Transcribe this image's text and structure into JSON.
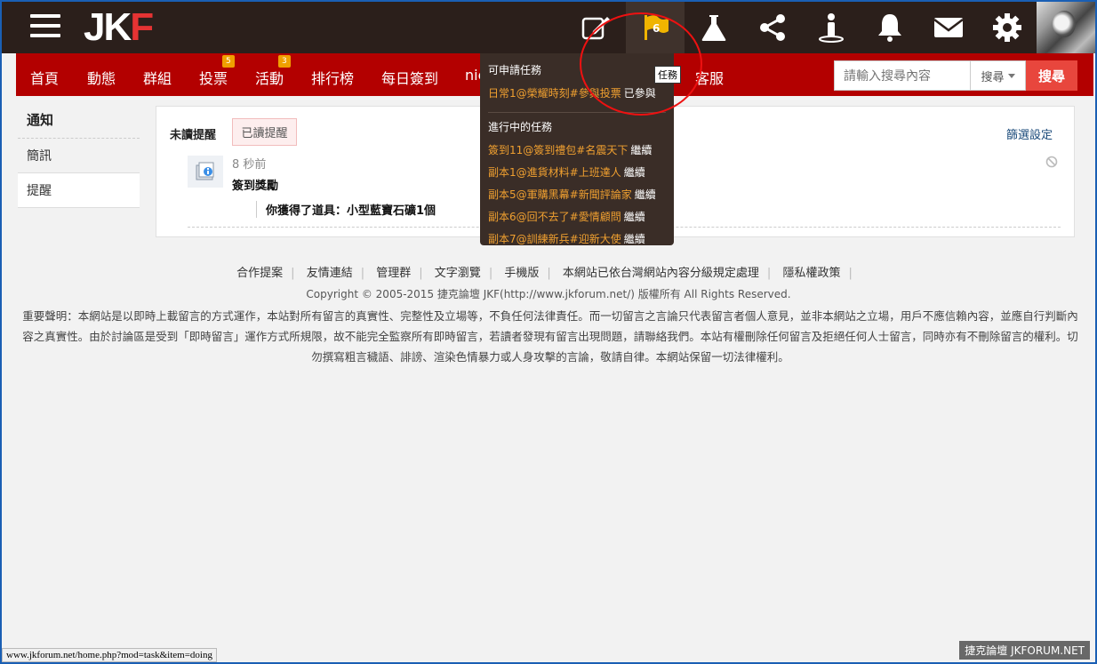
{
  "logo": {
    "main": "JK",
    "accent": "F"
  },
  "topicons": [
    {
      "name": "edit-icon"
    },
    {
      "name": "task-flag-icon",
      "count": "6"
    },
    {
      "name": "flask-icon"
    },
    {
      "name": "share-icon"
    },
    {
      "name": "info-person-icon"
    },
    {
      "name": "bell-icon"
    },
    {
      "name": "mail-icon"
    },
    {
      "name": "gear-icon"
    }
  ],
  "nav": {
    "items": [
      {
        "label": "首頁"
      },
      {
        "label": "動態"
      },
      {
        "label": "群組"
      },
      {
        "label": "投票",
        "badge": "5"
      },
      {
        "label": "活動",
        "badge": "3"
      },
      {
        "label": "排行榜"
      },
      {
        "label": "每日簽到"
      },
      {
        "label": "nic"
      },
      {
        "label": "客服"
      }
    ],
    "search_placeholder": "請輸入搜尋內容",
    "search_select": "搜尋",
    "search_button": "搜尋"
  },
  "sidebar": {
    "title": "通知",
    "items": [
      "簡訊",
      "提醒"
    ]
  },
  "panel": {
    "tab_unread": "未讀提醒",
    "tab_read": "已讀提醒",
    "filter": "篩選設定",
    "notice_time": "8 秒前",
    "notice_title": "簽到獎勵",
    "notice_body": "你獲得了道具：小型藍寶石礦1個"
  },
  "tasks_dropdown": {
    "available_heading": "可申請任務",
    "available": [
      {
        "name": "日常1@榮耀時刻#參與投票",
        "action": "已參與"
      }
    ],
    "in_progress_heading": "進行中的任務",
    "in_progress": [
      {
        "name": "簽到11@簽到禮包#名震天下",
        "action": "繼續"
      },
      {
        "name": "副本1@進貨材料#上班達人",
        "action": "繼續"
      },
      {
        "name": "副本5@軍購黑幕#新聞評論家",
        "action": "繼續"
      },
      {
        "name": "副本6@回不去了#愛情顧問",
        "action": "繼續"
      },
      {
        "name": "副本7@訓練新兵#迎新大使",
        "action": "繼續"
      }
    ],
    "tooltip": "任務"
  },
  "footer": {
    "links": [
      "合作提案",
      "友情連結",
      "管理群",
      "文字瀏覽",
      "手機版",
      "本網站已依台灣網站內容分級規定處理",
      "隱私權政策"
    ],
    "copyright": "Copyright © 2005-2015 捷克論壇 JKF(http://www.jkforum.net/) 版權所有 All Rights Reserved.",
    "disclaimer": "重要聲明：本網站是以即時上載留言的方式運作，本站對所有留言的真實性、完整性及立場等，不負任何法律責任。而一切留言之言論只代表留言者個人意見，並非本網站之立場，用戶不應信賴內容，並應自行判斷內容之真實性。由於討論區是受到「即時留言」運作方式所規限，故不能完全監察所有即時留言，若讀者發現有留言出現問題，請聯絡我們。本站有權刪除任何留言及拒絕任何人士留言，同時亦有不刪除留言的權利。切勿撰寫粗言穢語、誹謗、渲染色情暴力或人身攻擊的言論，敬請自律。本網站保留一切法律權利。"
  },
  "statusbar": "www.jkforum.net/home.php?mod=task&item=doing",
  "watermark": "捷克論壇 JKFORUM.NET",
  "colors": {
    "topbar": "#2b1f1b",
    "nav": "#b30000",
    "accent": "#e8463d",
    "task_link": "#f0a030"
  }
}
